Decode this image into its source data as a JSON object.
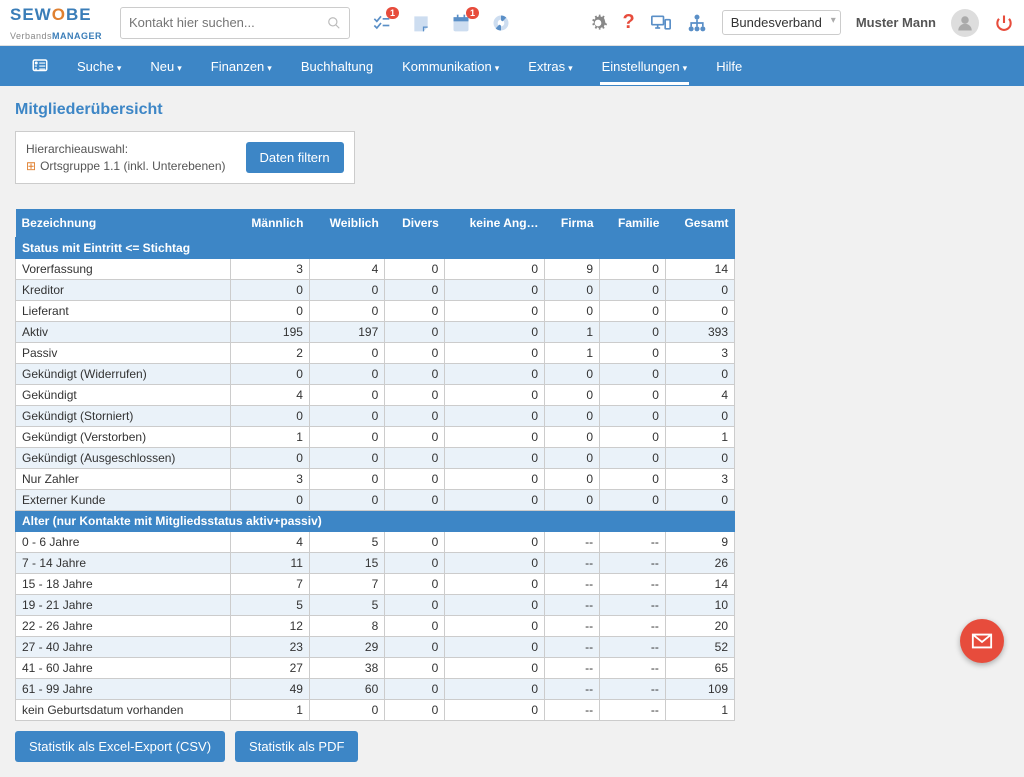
{
  "app": {
    "logo_top": "SEW",
    "logo_o": "O",
    "logo_top2": "BE",
    "logo_sub_pre": "Verbands",
    "logo_sub_bold": "MANAGER"
  },
  "search": {
    "placeholder": "Kontakt hier suchen..."
  },
  "badges": {
    "tasks": "1",
    "alerts": "1"
  },
  "org_selector": "Bundesverband",
  "user_name": "Muster Mann",
  "menu": {
    "home": "",
    "suche": "Suche",
    "neu": "Neu",
    "finanzen": "Finanzen",
    "buchhaltung": "Buchhaltung",
    "kommunikation": "Kommunikation",
    "extras": "Extras",
    "einstellungen": "Einstellungen",
    "hilfe": "Hilfe"
  },
  "page_title": "Mitgliederübersicht",
  "filter": {
    "label": "Hierarchieauswahl:",
    "value": "Ortsgruppe 1.1 (inkl. Unterebenen)",
    "button": "Daten filtern"
  },
  "table": {
    "headers": [
      "Bezeichnung",
      "Männlich",
      "Weiblich",
      "Divers",
      "keine Ang…",
      "Firma",
      "Familie",
      "Gesamt"
    ],
    "section1": "Status mit Eintritt <= Stichtag",
    "rows1": [
      {
        "l": "Vorerfassung",
        "v": [
          "3",
          "4",
          "0",
          "0",
          "9",
          "0",
          "14"
        ]
      },
      {
        "l": "Kreditor",
        "v": [
          "0",
          "0",
          "0",
          "0",
          "0",
          "0",
          "0"
        ]
      },
      {
        "l": "Lieferant",
        "v": [
          "0",
          "0",
          "0",
          "0",
          "0",
          "0",
          "0"
        ]
      },
      {
        "l": "Aktiv",
        "v": [
          "195",
          "197",
          "0",
          "0",
          "1",
          "0",
          "393"
        ]
      },
      {
        "l": "Passiv",
        "v": [
          "2",
          "0",
          "0",
          "0",
          "1",
          "0",
          "3"
        ]
      },
      {
        "l": "Gekündigt (Widerrufen)",
        "v": [
          "0",
          "0",
          "0",
          "0",
          "0",
          "0",
          "0"
        ]
      },
      {
        "l": "Gekündigt",
        "v": [
          "4",
          "0",
          "0",
          "0",
          "0",
          "0",
          "4"
        ]
      },
      {
        "l": "Gekündigt (Storniert)",
        "v": [
          "0",
          "0",
          "0",
          "0",
          "0",
          "0",
          "0"
        ]
      },
      {
        "l": "Gekündigt (Verstorben)",
        "v": [
          "1",
          "0",
          "0",
          "0",
          "0",
          "0",
          "1"
        ]
      },
      {
        "l": "Gekündigt (Ausgeschlossen)",
        "v": [
          "0",
          "0",
          "0",
          "0",
          "0",
          "0",
          "0"
        ]
      },
      {
        "l": "Nur Zahler",
        "v": [
          "3",
          "0",
          "0",
          "0",
          "0",
          "0",
          "3"
        ]
      },
      {
        "l": "Externer Kunde",
        "v": [
          "0",
          "0",
          "0",
          "0",
          "0",
          "0",
          "0"
        ]
      }
    ],
    "section2": "Alter (nur Kontakte mit Mitgliedsstatus aktiv+passiv)",
    "rows2": [
      {
        "l": "0 - 6 Jahre",
        "v": [
          "4",
          "5",
          "0",
          "0",
          "--",
          "--",
          "9"
        ]
      },
      {
        "l": "7 - 14 Jahre",
        "v": [
          "11",
          "15",
          "0",
          "0",
          "--",
          "--",
          "26"
        ]
      },
      {
        "l": "15 - 18 Jahre",
        "v": [
          "7",
          "7",
          "0",
          "0",
          "--",
          "--",
          "14"
        ]
      },
      {
        "l": "19 - 21 Jahre",
        "v": [
          "5",
          "5",
          "0",
          "0",
          "--",
          "--",
          "10"
        ]
      },
      {
        "l": "22 - 26 Jahre",
        "v": [
          "12",
          "8",
          "0",
          "0",
          "--",
          "--",
          "20"
        ]
      },
      {
        "l": "27 - 40 Jahre",
        "v": [
          "23",
          "29",
          "0",
          "0",
          "--",
          "--",
          "52"
        ]
      },
      {
        "l": "41 - 60 Jahre",
        "v": [
          "27",
          "38",
          "0",
          "0",
          "--",
          "--",
          "65"
        ]
      },
      {
        "l": "61 - 99 Jahre",
        "v": [
          "49",
          "60",
          "0",
          "0",
          "--",
          "--",
          "109"
        ]
      },
      {
        "l": "kein Geburtsdatum vorhanden",
        "v": [
          "1",
          "0",
          "0",
          "0",
          "--",
          "--",
          "1"
        ]
      }
    ]
  },
  "export": {
    "csv": "Statistik als Excel-Export (CSV)",
    "pdf": "Statistik als PDF"
  }
}
